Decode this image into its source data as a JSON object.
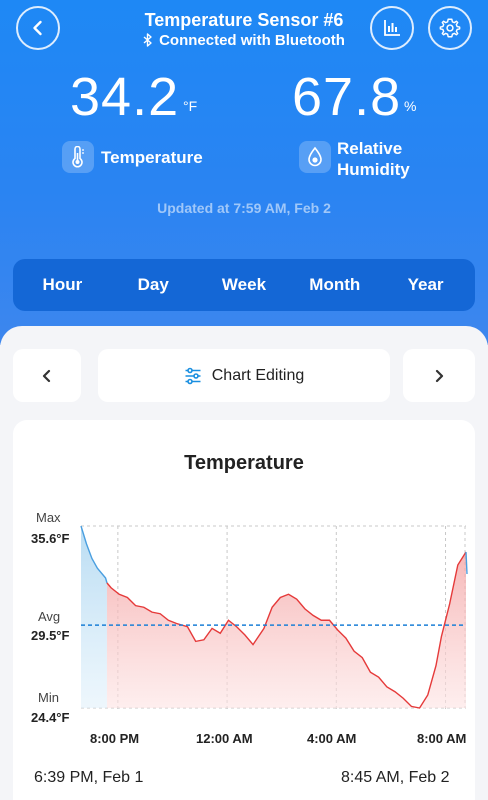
{
  "header": {
    "title": "Temperature Sensor #6",
    "subtitle": "Connected with Bluetooth",
    "temperature": {
      "value": "34.2",
      "unit": "°F",
      "label": "Temperature"
    },
    "humidity": {
      "value": "67.8",
      "unit": "%",
      "label_line1": "Relative",
      "label_line2": "Humidity"
    },
    "updated": "Updated at 7:59 AM,  Feb 2"
  },
  "tabs": [
    "Hour",
    "Day",
    "Week",
    "Month",
    "Year"
  ],
  "toolbar": {
    "edit_label": "Chart Editing"
  },
  "chart": {
    "title": "Temperature",
    "max_label": "Max",
    "max_value": "35.6°F",
    "avg_label": "Avg",
    "avg_value": "29.5°F",
    "min_label": "Min",
    "min_value": "24.4°F",
    "x_ticks": [
      "8:00 PM",
      "12:00 AM",
      "4:00 AM",
      "8:00 AM"
    ],
    "range_start": "6:39 PM,  Feb 1",
    "range_end": "8:45 AM,  Feb 2"
  },
  "chart_data": {
    "type": "area",
    "title": "Temperature",
    "x_unit": "hours since 6:39 PM Feb 1",
    "x": [
      0,
      0.2,
      0.4,
      0.6,
      0.9,
      1.1,
      1.4,
      1.7,
      2.0,
      2.3,
      2.6,
      2.9,
      3.2,
      3.5,
      3.9,
      4.2,
      4.5,
      4.8,
      5.1,
      5.4,
      5.7,
      6.0,
      6.3,
      6.7,
      7.0,
      7.3,
      7.6,
      7.9,
      8.2,
      8.5,
      8.8,
      9.1,
      9.4,
      9.7,
      10.0,
      10.3,
      10.6,
      10.9,
      11.2,
      11.5,
      11.8,
      12.1,
      12.4,
      12.7,
      13.0,
      13.2,
      13.5,
      13.8,
      14.1
    ],
    "values": [
      35.6,
      34.5,
      33.6,
      33.0,
      32.4,
      31.8,
      31.4,
      31.2,
      30.7,
      30.6,
      30.3,
      30.2,
      29.8,
      29.6,
      29.4,
      28.5,
      28.6,
      29.3,
      29.0,
      29.8,
      29.4,
      28.9,
      28.3,
      29.3,
      30.6,
      31.2,
      31.4,
      31.1,
      30.5,
      30.1,
      29.8,
      29.8,
      29.2,
      28.7,
      27.9,
      27.5,
      26.6,
      26.3,
      25.7,
      25.4,
      25.0,
      24.5,
      24.4,
      25.2,
      27.0,
      28.8,
      30.8,
      33.2,
      34.0
    ],
    "ylim": [
      24.4,
      35.6
    ],
    "avg": 29.5,
    "x_ticks": [
      "8:00 PM",
      "12:00 AM",
      "4:00 AM",
      "8:00 AM"
    ],
    "fill_colors": {
      "above_avg": "#4a9fe0",
      "below_avg": "#e53a3a"
    },
    "avg_line_color": "#1a7fd6"
  }
}
